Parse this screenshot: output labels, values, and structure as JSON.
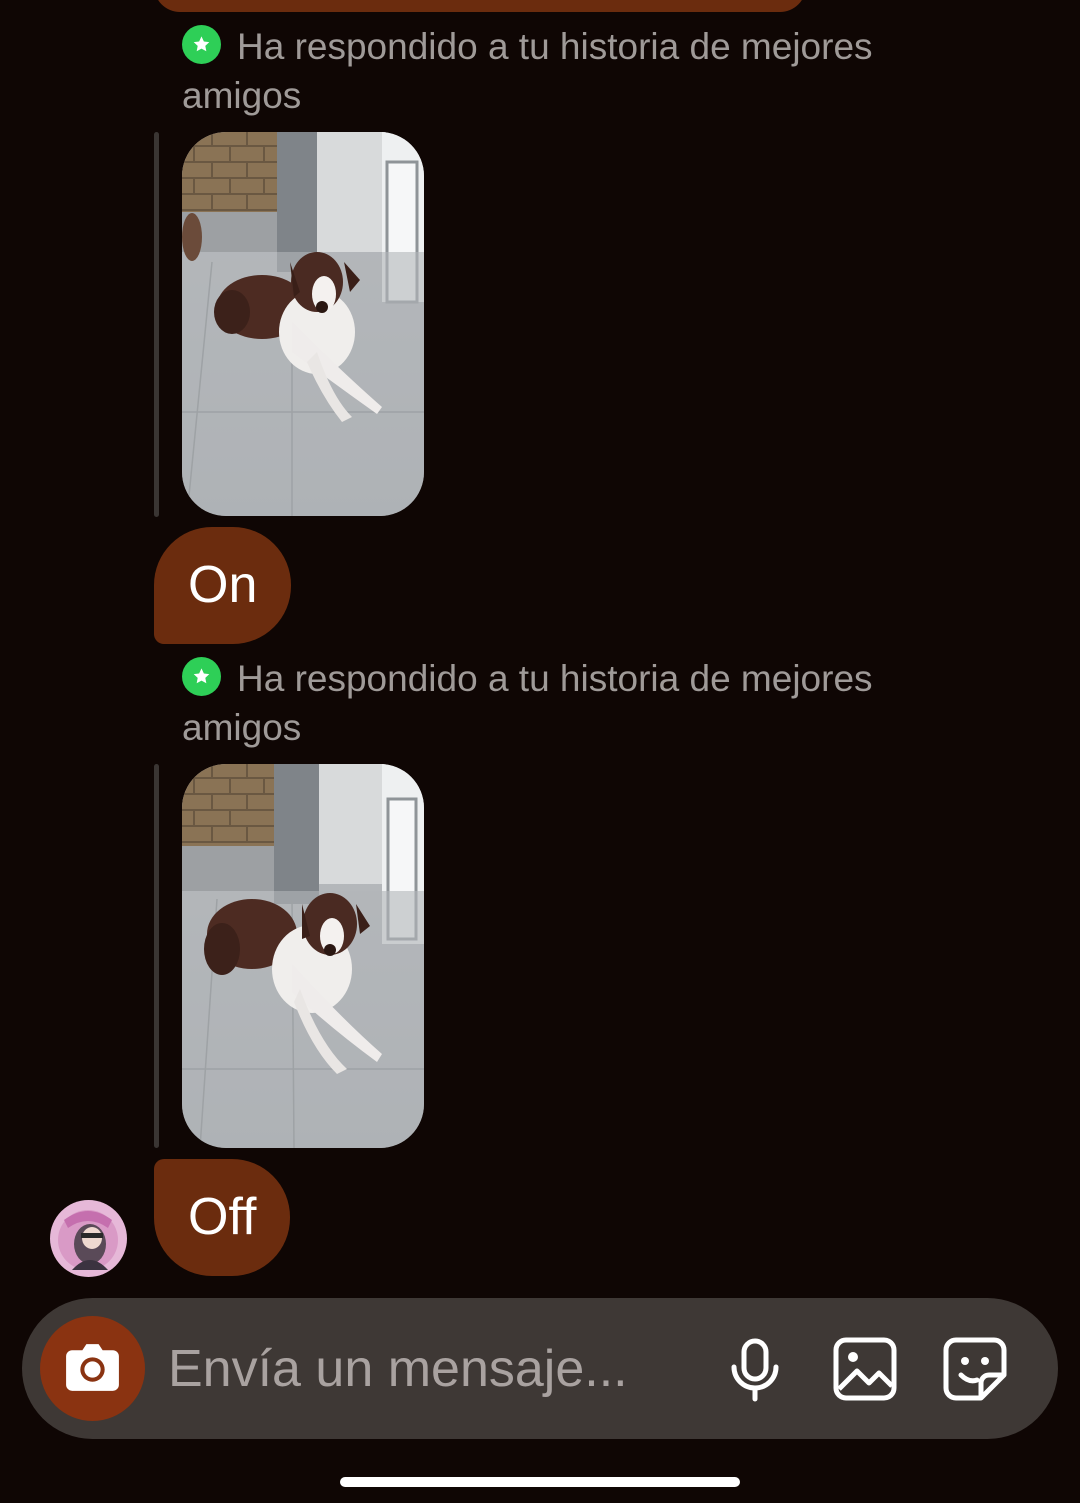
{
  "conversation": {
    "messages": [
      {
        "type": "story_reply",
        "note": "Ha respondido a tu historia de mejores amigos",
        "badge_icon": "close-friends-star-icon",
        "badge_color": "#2ecf57",
        "thumbnail": "story-thumbnail-dog",
        "text": "On"
      },
      {
        "type": "story_reply",
        "note": "Ha respondido a tu historia de mejores amigos",
        "badge_icon": "close-friends-star-icon",
        "badge_color": "#2ecf57",
        "thumbnail": "story-thumbnail-dog",
        "text": "Off"
      }
    ],
    "bubble_color": "#6b2c0e",
    "background_color": "#0f0604"
  },
  "composer": {
    "placeholder": "Envía un mensaje...",
    "camera_icon": "camera-icon",
    "camera_color": "#8a3311",
    "tools": [
      "microphone-icon",
      "gallery-icon",
      "sticker-icon"
    ]
  }
}
